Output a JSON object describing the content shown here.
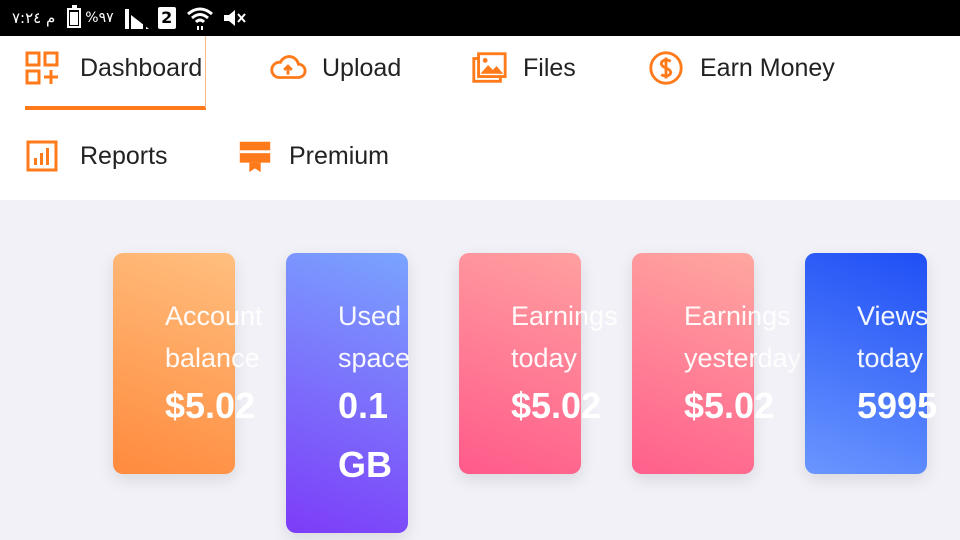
{
  "status_bar": {
    "time": "م ٧:٢٤",
    "battery": "%٩٧",
    "sim": "2"
  },
  "nav": {
    "items": [
      {
        "label": "Dashboard",
        "icon": "dashboard-grid-icon",
        "active": true
      },
      {
        "label": "Upload",
        "icon": "cloud-upload-icon"
      },
      {
        "label": "Files",
        "icon": "images-icon"
      },
      {
        "label": "Earn Money",
        "icon": "dollar-icon"
      },
      {
        "label": "Reports",
        "icon": "chart-icon"
      },
      {
        "label": "Premium",
        "icon": "premium-badge-icon"
      }
    ]
  },
  "stats": [
    {
      "label": "Account\nbalance",
      "value": "$5.02"
    },
    {
      "label": " Used\nspace",
      "value": "0.1\nGB"
    },
    {
      "label": "Earnings\ntoday",
      "value": "$5.02"
    },
    {
      "label": "Earnings\nyesterday",
      "value": "$5.02"
    },
    {
      "label": "Views\ntoday",
      "value": "5995"
    }
  ],
  "colors": {
    "accent": "#ff7a1a",
    "status_bar_bg": "#000000",
    "page_bg": "#f1f1f7"
  }
}
